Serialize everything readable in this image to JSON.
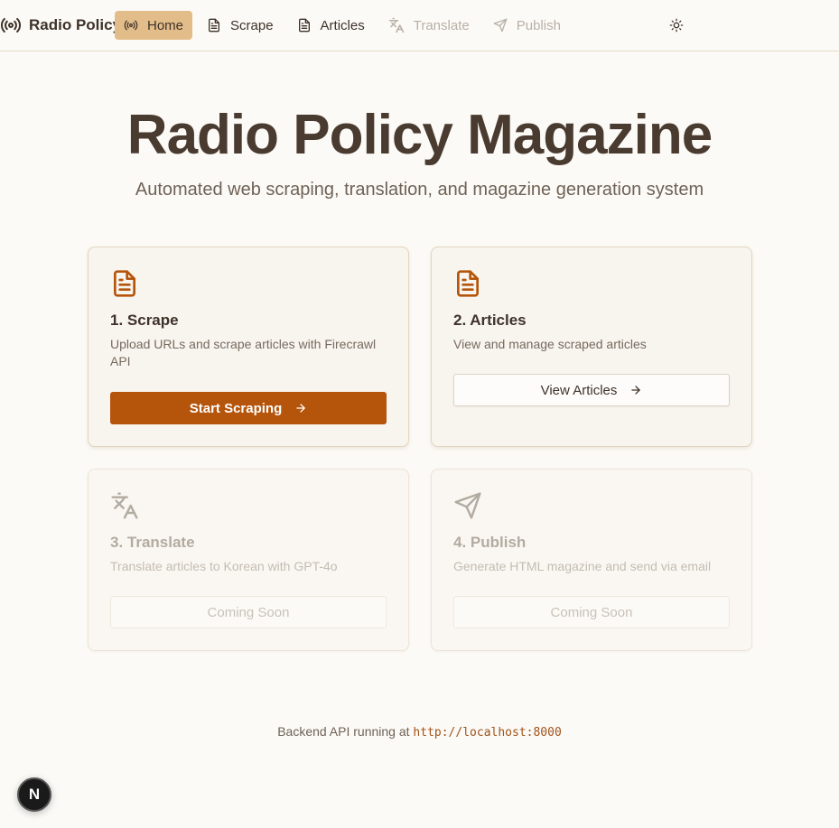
{
  "header": {
    "brand": "Radio Policy",
    "brand_icon": "radio-broadcast-icon",
    "nav": [
      {
        "label": "Home",
        "icon": "radio-broadcast-icon",
        "state": "active"
      },
      {
        "label": "Scrape",
        "icon": "document-icon",
        "state": "normal"
      },
      {
        "label": "Articles",
        "icon": "document-icon",
        "state": "normal"
      },
      {
        "label": "Translate",
        "icon": "translate-icon",
        "state": "disabled"
      },
      {
        "label": "Publish",
        "icon": "send-icon",
        "state": "disabled"
      }
    ],
    "theme_toggle_icon": "sun-icon"
  },
  "hero": {
    "title": "Radio Policy Magazine",
    "subtitle": "Automated web scraping, translation, and magazine generation system"
  },
  "cards": [
    {
      "title": "1. Scrape",
      "description": "Upload URLs and scrape articles with Firecrawl API",
      "button": "Start Scraping",
      "icon": "document-icon",
      "state": "enabled"
    },
    {
      "title": "2. Articles",
      "description": "View and manage scraped articles",
      "button": "View Articles",
      "icon": "document-icon",
      "state": "enabled"
    },
    {
      "title": "3. Translate",
      "description": "Translate articles to Korean with GPT-4o",
      "button": "Coming Soon",
      "icon": "translate-icon",
      "state": "disabled"
    },
    {
      "title": "4. Publish",
      "description": "Generate HTML magazine and send via email",
      "button": "Coming Soon",
      "icon": "send-icon",
      "state": "disabled"
    }
  ],
  "footer": {
    "prefix": "Backend API running at",
    "url": "http://localhost:8000"
  },
  "dev_badge": "N",
  "colors": {
    "accent": "#b5540b",
    "active_nav": "#e3bd89",
    "background": "#fcfaf6",
    "text": "#4a3b30"
  }
}
